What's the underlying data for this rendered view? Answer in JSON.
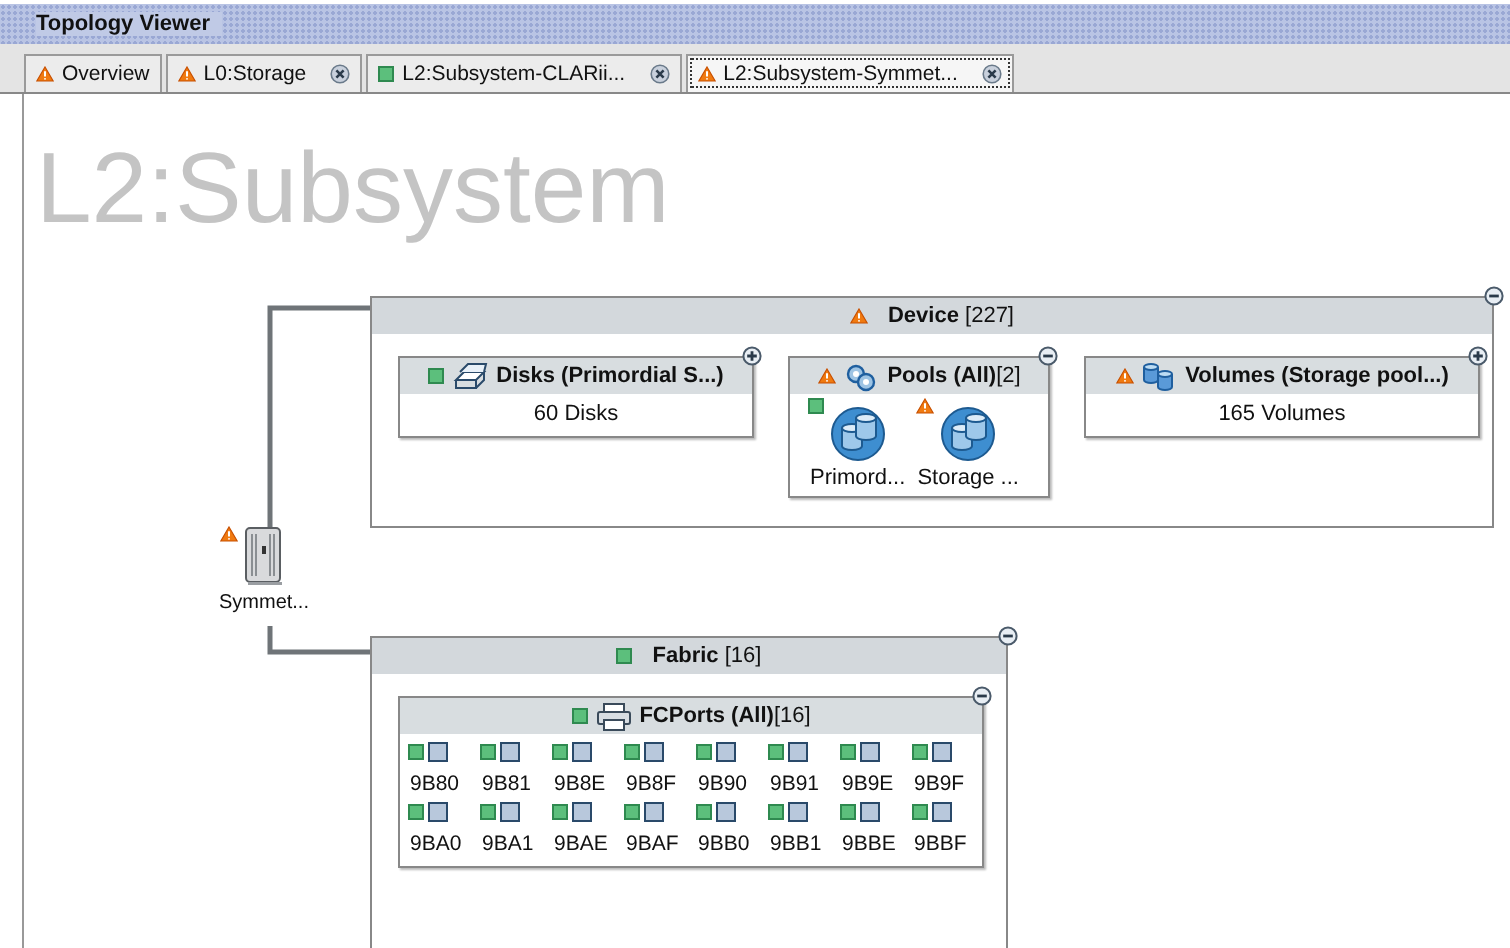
{
  "window": {
    "title": "Topology Viewer"
  },
  "tabs": [
    {
      "label": "Overview",
      "warning": true,
      "closable": false,
      "selected": false
    },
    {
      "label": "L0:Storage",
      "warning": true,
      "closable": true,
      "selected": false
    },
    {
      "label": "L2:Subsystem-CLARii...",
      "warning": false,
      "closable": true,
      "selected": false
    },
    {
      "label": "L2:Subsystem-Symmet...",
      "warning": true,
      "closable": true,
      "selected": true
    }
  ],
  "view_title": "L2:Subsystem",
  "subsystem": {
    "label": "Symmet...",
    "warning": true
  },
  "groups": [
    {
      "title": "Device",
      "count": "[227]",
      "warning": true,
      "expanded": true,
      "boxes": [
        {
          "kind": "disks",
          "title": "Disks (Primordial S...)",
          "warning": false,
          "expanded": false,
          "summary": "60 Disks"
        },
        {
          "kind": "pools",
          "title": "Pools (All)",
          "count": "[2]",
          "warning": true,
          "expanded": true,
          "items": [
            {
              "label": "Primord...",
              "warning": false
            },
            {
              "label": "Storage ...",
              "warning": true
            }
          ]
        },
        {
          "kind": "volumes",
          "title": "Volumes (Storage pool...)",
          "warning": true,
          "expanded": false,
          "summary": "165 Volumes"
        }
      ]
    },
    {
      "title": "Fabric",
      "count": "[16]",
      "warning": false,
      "expanded": true,
      "boxes": [
        {
          "kind": "ports",
          "title": "FCPorts (All)",
          "count": "[16]",
          "warning": false,
          "expanded": true,
          "items": [
            {
              "label": "9B80",
              "warning": false
            },
            {
              "label": "9B81",
              "warning": false
            },
            {
              "label": "9B8E",
              "warning": false
            },
            {
              "label": "9B8F",
              "warning": false
            },
            {
              "label": "9B90",
              "warning": false
            },
            {
              "label": "9B91",
              "warning": false
            },
            {
              "label": "9B9E",
              "warning": false
            },
            {
              "label": "9B9F",
              "warning": false
            },
            {
              "label": "9BA0",
              "warning": false
            },
            {
              "label": "9BA1",
              "warning": false
            },
            {
              "label": "9BAE",
              "warning": false
            },
            {
              "label": "9BAF",
              "warning": false
            },
            {
              "label": "9BB0",
              "warning": false
            },
            {
              "label": "9BB1",
              "warning": false
            },
            {
              "label": "9BBE",
              "warning": false
            },
            {
              "label": "9BBF",
              "warning": false
            }
          ]
        }
      ]
    }
  ]
}
